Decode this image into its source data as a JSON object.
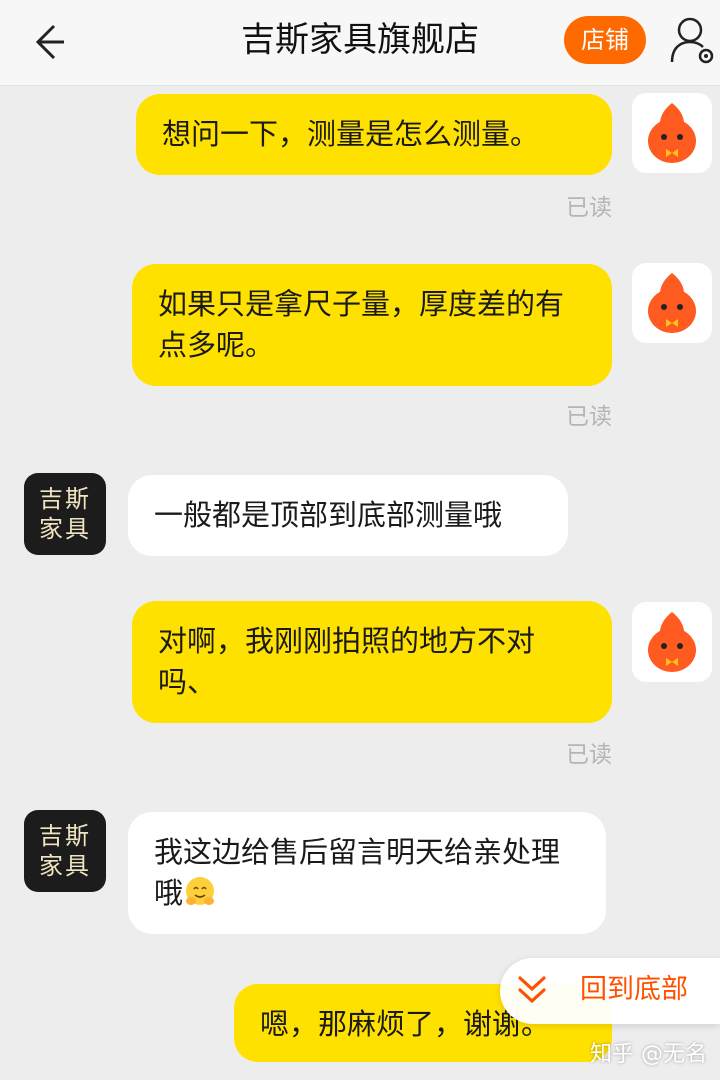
{
  "header": {
    "back_icon": "back-arrow-icon",
    "title": "吉斯家具旗舰店",
    "store_button": "店铺",
    "user_icon": "user-settings-icon"
  },
  "shop_avatar": {
    "line1": "吉斯",
    "line2": "家具"
  },
  "messages": [
    {
      "from": "me",
      "text": "想问一下，测量是怎么测量。",
      "status": "已读"
    },
    {
      "from": "me",
      "text": "如果只是拿尺子量，厚度差的有点多呢。",
      "status": "已读"
    },
    {
      "from": "shop",
      "text": "一般都是顶部到底部测量哦"
    },
    {
      "from": "me",
      "text": "对啊，我刚刚拍照的地方不对吗、",
      "status": "已读"
    },
    {
      "from": "shop",
      "text": "我这边给售后留言明天给亲处理哦",
      "emoji": "hugging-face-emoji"
    },
    {
      "from": "me",
      "text": "嗯，那麻烦了，谢谢。"
    }
  ],
  "back_to_bottom": {
    "label": "回到底部",
    "icon": "double-chevron-down-icon"
  },
  "watermark": "知乎 @无名",
  "colors": {
    "accent": "#ff6a00",
    "my_bubble": "#ffe100",
    "background": "#ededed"
  }
}
